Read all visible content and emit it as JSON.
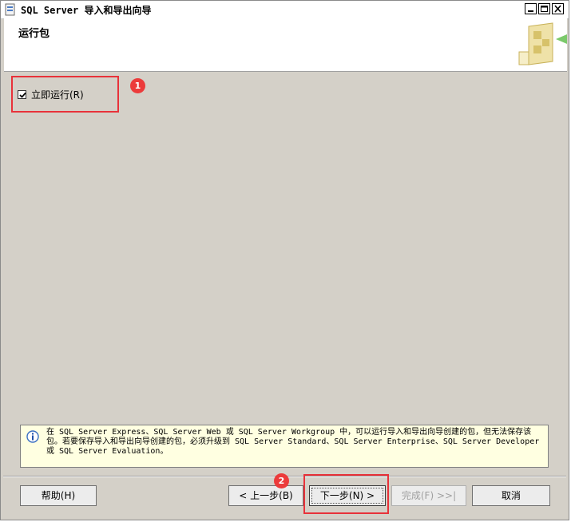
{
  "window": {
    "title": "SQL Server 导入和导出向导"
  },
  "header": {
    "title": "运行包"
  },
  "options": {
    "run_immediately": {
      "label": "立即运行(R)",
      "checked": true
    }
  },
  "annotations": {
    "badge_1": "1",
    "badge_2": "2"
  },
  "info": {
    "icon": "info-icon",
    "text": "在 SQL Server Express、SQL Server Web 或 SQL Server Workgroup 中，可以运行导入和导出向导创建的包，但无法保存该包。若要保存导入和导出向导创建的包，必须升级到 SQL Server Standard、SQL Server Enterprise、SQL Server Developer 或 SQL Server Evaluation。"
  },
  "buttons": {
    "help": "帮助(H)",
    "back": "< 上一步(B)",
    "next": "下一步(N) >",
    "finish": "完成(F) >>|",
    "cancel": "取消"
  },
  "colors": {
    "highlight_red": "#e8323a",
    "info_background": "#ffffe1",
    "dialog_background": "#d4d0c8"
  }
}
